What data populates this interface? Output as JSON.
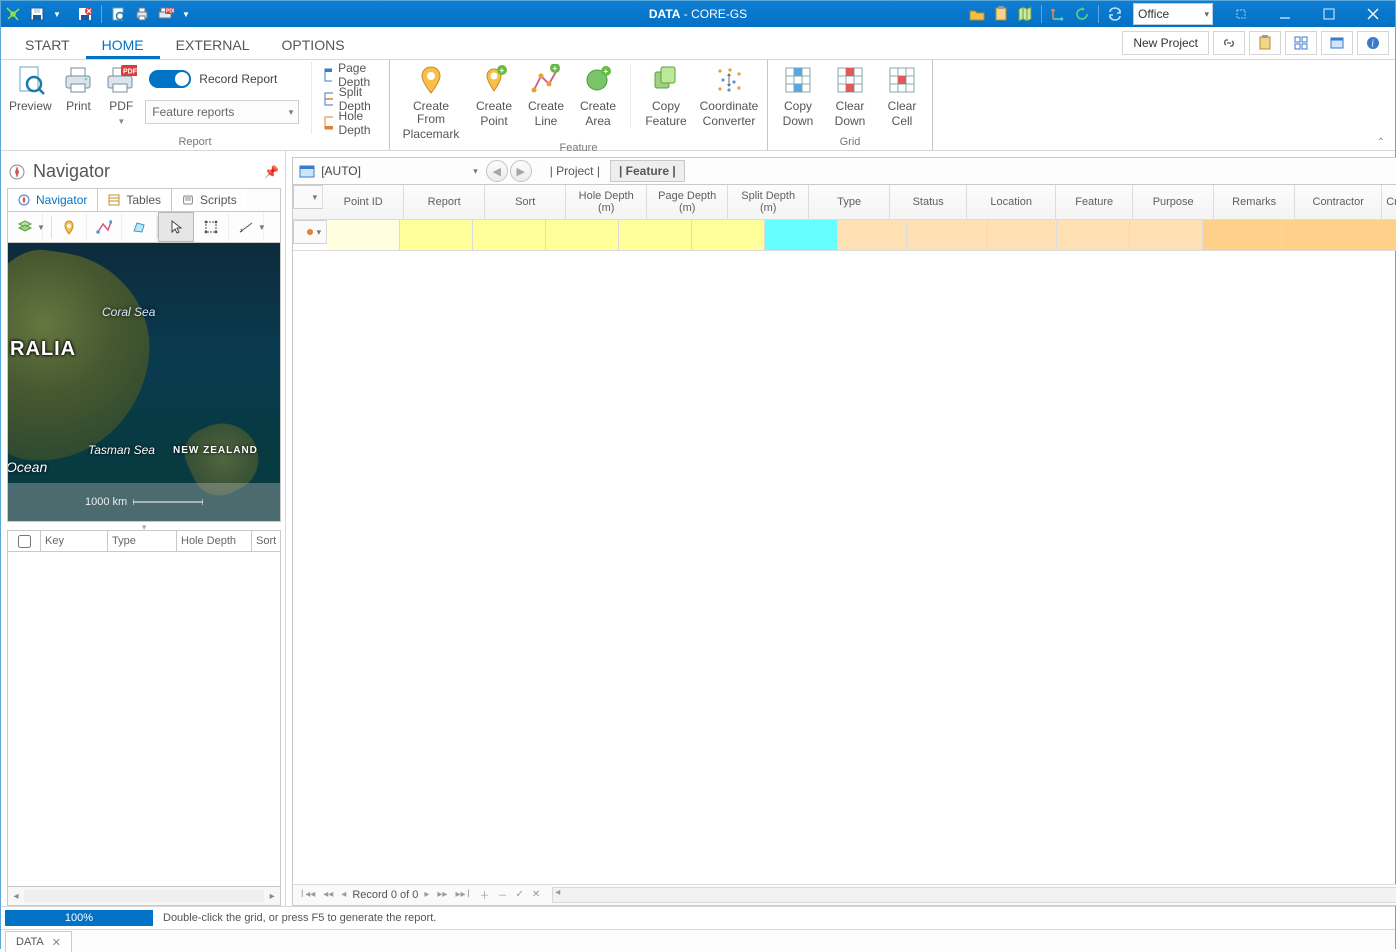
{
  "title": {
    "prefix": "DATA",
    "sep": " - ",
    "suffix": "CORE-GS"
  },
  "title_right_combo": "Office",
  "tabs": {
    "start": "START",
    "home": "HOME",
    "external": "EXTERNAL",
    "options": "OPTIONS"
  },
  "menu_right": {
    "new_project": "New Project"
  },
  "ribbon": {
    "report": {
      "preview": "Preview",
      "print": "Print",
      "pdf": "PDF",
      "record_report": "Record Report",
      "feature_reports": "Feature reports",
      "page_depth": "Page Depth",
      "split_depth": "Split Depth",
      "hole_depth": "Hole Depth",
      "group": "Report"
    },
    "feature": {
      "from_placemark_l1": "Create From",
      "from_placemark_l2": "Placemark",
      "create_point_l1": "Create",
      "create_point_l2": "Point",
      "create_line_l1": "Create",
      "create_line_l2": "Line",
      "create_area_l1": "Create",
      "create_area_l2": "Area",
      "copy_feature_l1": "Copy",
      "copy_feature_l2": "Feature",
      "coord_conv_l1": "Coordinate",
      "coord_conv_l2": "Converter",
      "group": "Feature"
    },
    "grid": {
      "copy_down_l1": "Copy",
      "copy_down_l2": "Down",
      "clear_down_l1": "Clear",
      "clear_down_l2": "Down",
      "clear_cell_l1": "Clear",
      "clear_cell_l2": "Cell",
      "group": "Grid"
    }
  },
  "navigator": {
    "title": "Navigator",
    "tab_nav": "Navigator",
    "tab_tables": "Tables",
    "tab_scripts": "Scripts",
    "map": {
      "coral": "Coral Sea",
      "ralia": "RALIA",
      "tasman": "Tasman Sea",
      "nz": "NEW ZEALAND",
      "ocean": "Ocean",
      "scale": "1000 km"
    },
    "mini_cols": {
      "key": "Key",
      "type": "Type",
      "hole": "Hole Depth",
      "sort": "Sort"
    }
  },
  "feature_bar": {
    "auto": "[AUTO]",
    "project": "| Project |",
    "feature": "| Feature |"
  },
  "columns": {
    "point": "Point ID",
    "report": "Report",
    "sort": "Sort",
    "hole": "Hole Depth (m)",
    "page": "Page Depth (m)",
    "split": "Split Depth (m)",
    "type": "Type",
    "status": "Status",
    "location": "Location",
    "feature": "Feature",
    "purpose": "Purpose",
    "remarks": "Remarks",
    "contractor": "Contractor",
    "crew": "Crew"
  },
  "grid_nav": {
    "record": "Record 0 of 0"
  },
  "status": {
    "progress": "100%",
    "hint": "Double-click the grid, or press F5 to generate the report."
  },
  "doc_tab": "DATA"
}
